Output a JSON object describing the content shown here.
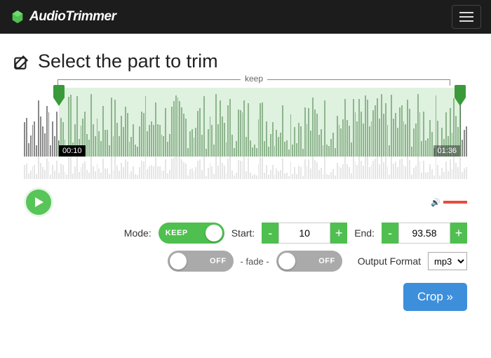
{
  "navbar": {
    "brand": "AudioTrimmer"
  },
  "heading": "Select the part to trim",
  "keep_label": "keep",
  "times": {
    "start_tag": "00:10",
    "end_tag": "01:36"
  },
  "controls": {
    "mode_label": "Mode:",
    "mode_value": "KEEP",
    "start_label": "Start:",
    "start_value": "10",
    "end_label": "End:",
    "end_value": "93.58",
    "minus": "-",
    "plus": "+",
    "fade_label": "- fade -",
    "off": "OFF",
    "format_label": "Output Format",
    "format_value": "mp3"
  },
  "crop_label": "Crop »"
}
